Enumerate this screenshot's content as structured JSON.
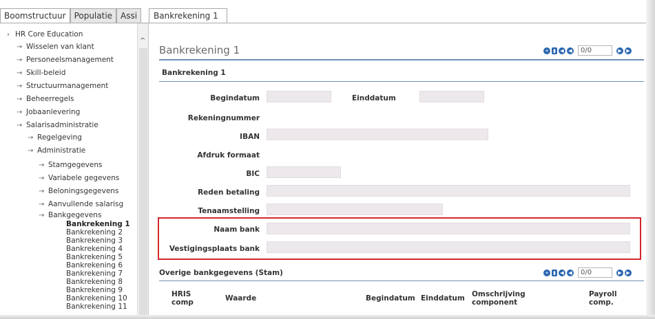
{
  "tabs": {
    "left": [
      "Boomstructuur",
      "Populatie",
      "Assi"
    ],
    "right": "Bankrekening 1"
  },
  "tree": {
    "root": "HR Core Education",
    "level1": [
      "Wisselen van klant",
      "Personeelsmanagement",
      "Skill-beleid",
      "Structuurmanagement",
      "Beheerregels",
      "Jobaanlevering",
      "Salarisadministratie"
    ],
    "level2": [
      "Regelgeving",
      "Administratie"
    ],
    "level3": [
      "Stamgegevens",
      "Variabele gegevens",
      "Beloningsgegevens",
      "Aanvullende salarisg",
      "Bankgegevens"
    ],
    "leaves": [
      "Bankrekening 1",
      "Bankrekening 2",
      "Bankrekening 3",
      "Bankrekening 4",
      "Bankrekening 5",
      "Bankrekening 6",
      "Bankrekening 7",
      "Bankrekening 8",
      "Bankrekening 9",
      "Bankrekening 10",
      "Bankrekening 11"
    ]
  },
  "main": {
    "title": "Bankrekening 1",
    "pager": "0/0",
    "section1": "Bankrekening 1",
    "fields": {
      "begindatum": "Begindatum",
      "einddatum": "Einddatum",
      "rekeningnummer": "Rekeningnummer",
      "iban": "IBAN",
      "afdruk": "Afdruk formaat",
      "bic": "BIC",
      "reden": "Reden betaling",
      "tenaam": "Tenaamstelling",
      "naambank": "Naam bank",
      "vestiging": "Vestigingsplaats bank"
    },
    "section2": "Overige bankgegevens (Stam)",
    "pager2": "0/0",
    "table_headers": [
      "HRIS comp",
      "Waarde",
      "Begindatum",
      "Einddatum",
      "Omschrijving component",
      "Payroll comp."
    ]
  },
  "colors": {
    "accent": "#2a66b0",
    "highlight": "#d4262c",
    "field": "#ede8ec"
  }
}
